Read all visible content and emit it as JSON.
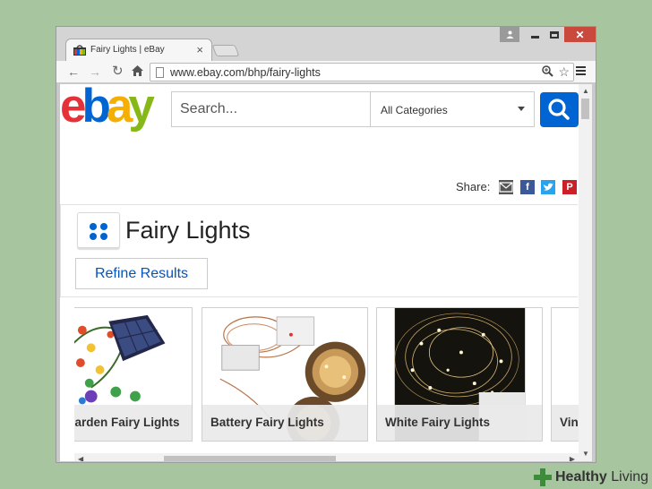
{
  "browser": {
    "tab_title": "Fairy Lights | eBay",
    "tab_close": "×",
    "url": "www.ebay.com/bhp/fairy-lights",
    "close_glyph": "✕"
  },
  "ebay": {
    "logo": {
      "e": "e",
      "b": "b",
      "a": "a",
      "y": "y"
    },
    "search_placeholder": "Search...",
    "category": "All Categories",
    "share_label": "Share:",
    "page_title": "Fairy Lights",
    "refine_label": "Refine Results",
    "products": [
      {
        "label": "Garden Fairy Lights"
      },
      {
        "label": "Battery Fairy Lights"
      },
      {
        "label": "White Fairy Lights"
      },
      {
        "label": "Vin"
      }
    ]
  },
  "watermark": {
    "brand_bold": "Healthy",
    "brand_rest": " Living"
  },
  "colors": {
    "ebay_blue": "#0064d2",
    "ebay_red": "#e53238",
    "ebay_yellow": "#f5af02",
    "ebay_green": "#86b817",
    "background": "#a7c69f"
  },
  "icons": [
    "back-icon",
    "forward-icon",
    "reload-icon",
    "home-icon",
    "page-icon",
    "zoom-icon",
    "star-icon",
    "menu-icon",
    "search-icon",
    "mail-icon",
    "facebook-icon",
    "twitter-icon",
    "pinterest-icon",
    "category-grid-icon"
  ]
}
